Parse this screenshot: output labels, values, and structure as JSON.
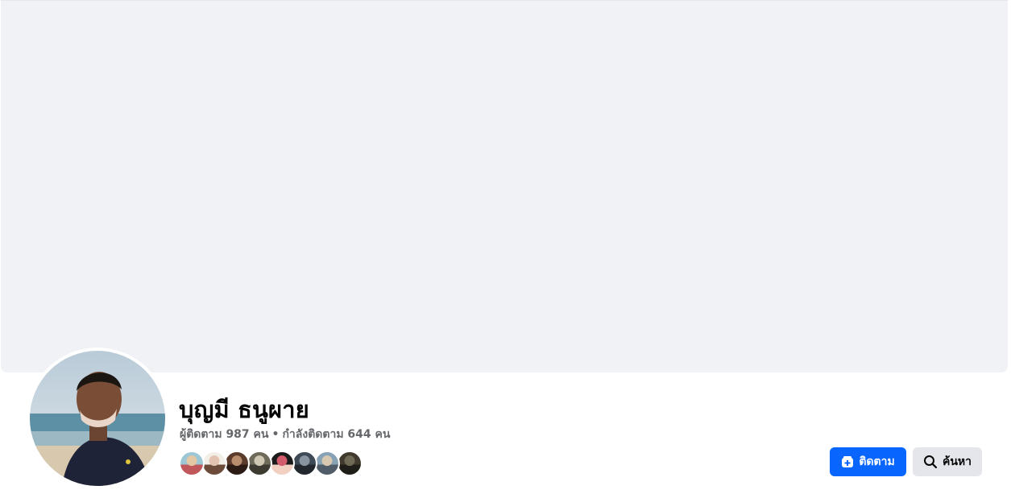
{
  "profile": {
    "name": "บุญมี ธนูผาย",
    "followers_label": "ผู้ติดตาม 987 คน",
    "separator": "•",
    "following_label": "กำลังติดตาม 644 คน"
  },
  "friends": [
    {
      "colors": [
        "#9ec7d6",
        "#e3c8a3",
        "#c0585b"
      ]
    },
    {
      "colors": [
        "#f2efe9",
        "#e2c2b0",
        "#6d4b3a"
      ]
    },
    {
      "colors": [
        "#5a3b2c",
        "#b88d6e",
        "#2b1b14"
      ]
    },
    {
      "colors": [
        "#6d6a5a",
        "#cfc7b2",
        "#3c3a31"
      ]
    },
    {
      "colors": [
        "#1b1b1b",
        "#d25c6b",
        "#f1d0c1"
      ]
    },
    {
      "colors": [
        "#3e4b57",
        "#8895a1",
        "#22282e"
      ]
    },
    {
      "colors": [
        "#87a2b5",
        "#d9c8b0",
        "#505d68"
      ]
    },
    {
      "colors": [
        "#3f3a2d",
        "#6e6a55",
        "#1f1d17"
      ]
    }
  ],
  "actions": {
    "follow_label": "ติดตาม",
    "search_label": "ค้นหา"
  },
  "theme": {
    "accent": "#0866ff",
    "secondary_button": "#e4e6eb",
    "cover_bg": "#f0f2f5",
    "muted_text": "#65676b"
  }
}
